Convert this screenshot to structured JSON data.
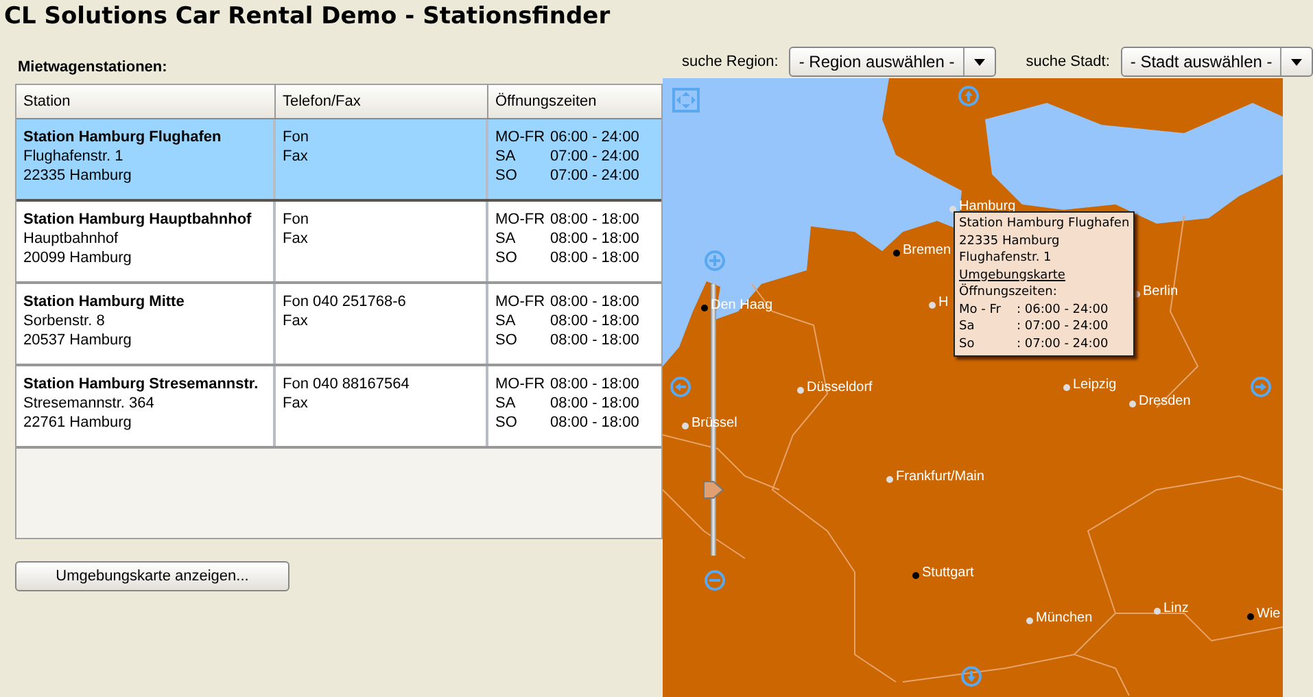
{
  "title": "CL Solutions Car Rental Demo - Stationsfinder",
  "list_label": "Mietwagenstationen:",
  "table": {
    "columns": [
      "Station",
      "Telefon/Fax",
      "Öffnungszeiten"
    ],
    "rows": [
      {
        "selected": true,
        "name": "Station Hamburg Flughafen",
        "street": "Flughafenstr. 1",
        "city": "22335 Hamburg",
        "phone": "Fon",
        "fax": "Fax",
        "hours": [
          {
            "day": "MO-FR",
            "time": "06:00 - 24:00"
          },
          {
            "day": "SA",
            "time": "07:00 - 24:00"
          },
          {
            "day": "SO",
            "time": "07:00 - 24:00"
          }
        ]
      },
      {
        "selected": false,
        "name": "Station Hamburg Hauptbahnhof",
        "street": "Hauptbahnhof",
        "city": "20099 Hamburg",
        "phone": "Fon",
        "fax": "Fax",
        "hours": [
          {
            "day": "MO-FR",
            "time": "08:00 - 18:00"
          },
          {
            "day": "SA",
            "time": "08:00 - 18:00"
          },
          {
            "day": "SO",
            "time": "08:00 - 18:00"
          }
        ]
      },
      {
        "selected": false,
        "name": "Station Hamburg Mitte",
        "street": "Sorbenstr. 8",
        "city": "20537 Hamburg",
        "phone": "Fon 040 251768-6",
        "fax": "Fax",
        "hours": [
          {
            "day": "MO-FR",
            "time": "08:00 - 18:00"
          },
          {
            "day": "SA",
            "time": "08:00 - 18:00"
          },
          {
            "day": "SO",
            "time": "08:00 - 18:00"
          }
        ]
      },
      {
        "selected": false,
        "name": "Station Hamburg Stresemannstr.",
        "street": "Stresemannstr. 364",
        "city": "22761 Hamburg",
        "phone": "Fon 040 88167564",
        "fax": "Fax",
        "hours": [
          {
            "day": "MO-FR",
            "time": "08:00 - 18:00"
          },
          {
            "day": "SA",
            "time": "08:00 - 18:00"
          },
          {
            "day": "SO",
            "time": "08:00 - 18:00"
          }
        ]
      }
    ]
  },
  "map_button": "Umgebungskarte anzeigen...",
  "filters": [
    {
      "label": "suche Region:",
      "value": "- Region auswählen -"
    },
    {
      "label": "suche Stadt:",
      "value": "- Stadt auswählen -"
    }
  ],
  "map": {
    "zoom_slider": {
      "level": 0.24
    },
    "cities": [
      {
        "name": "Hamburg",
        "dark": false
      },
      {
        "name": "Bremen",
        "dark": true
      },
      {
        "name": "H",
        "dark": false
      },
      {
        "name": "Berlin",
        "dark": false
      },
      {
        "name": "Den Haag",
        "dark": true
      },
      {
        "name": "Düsseldorf",
        "dark": false
      },
      {
        "name": "Brüssel",
        "dark": false
      },
      {
        "name": "Leipzig",
        "dark": false
      },
      {
        "name": "Dresden",
        "dark": false
      },
      {
        "name": "Frankfurt/Main",
        "dark": false
      },
      {
        "name": "Stuttgart",
        "dark": true
      },
      {
        "name": "München",
        "dark": false
      },
      {
        "name": "Linz",
        "dark": false
      },
      {
        "name": "Wie",
        "dark": true
      }
    ],
    "popup": {
      "lines": [
        "Station Hamburg Flughafen",
        "22335 Hamburg",
        "Flughafenstr. 1"
      ],
      "link": "Umgebungskarte",
      "hours_label": "Öffnungszeiten:",
      "hours": [
        {
          "day": "Mo - Fr",
          "time": ": 06:00 - 24:00"
        },
        {
          "day": "Sa",
          "time": ": 07:00 - 24:00"
        },
        {
          "day": "So",
          "time": ": 07:00 - 24:00"
        }
      ]
    }
  }
}
